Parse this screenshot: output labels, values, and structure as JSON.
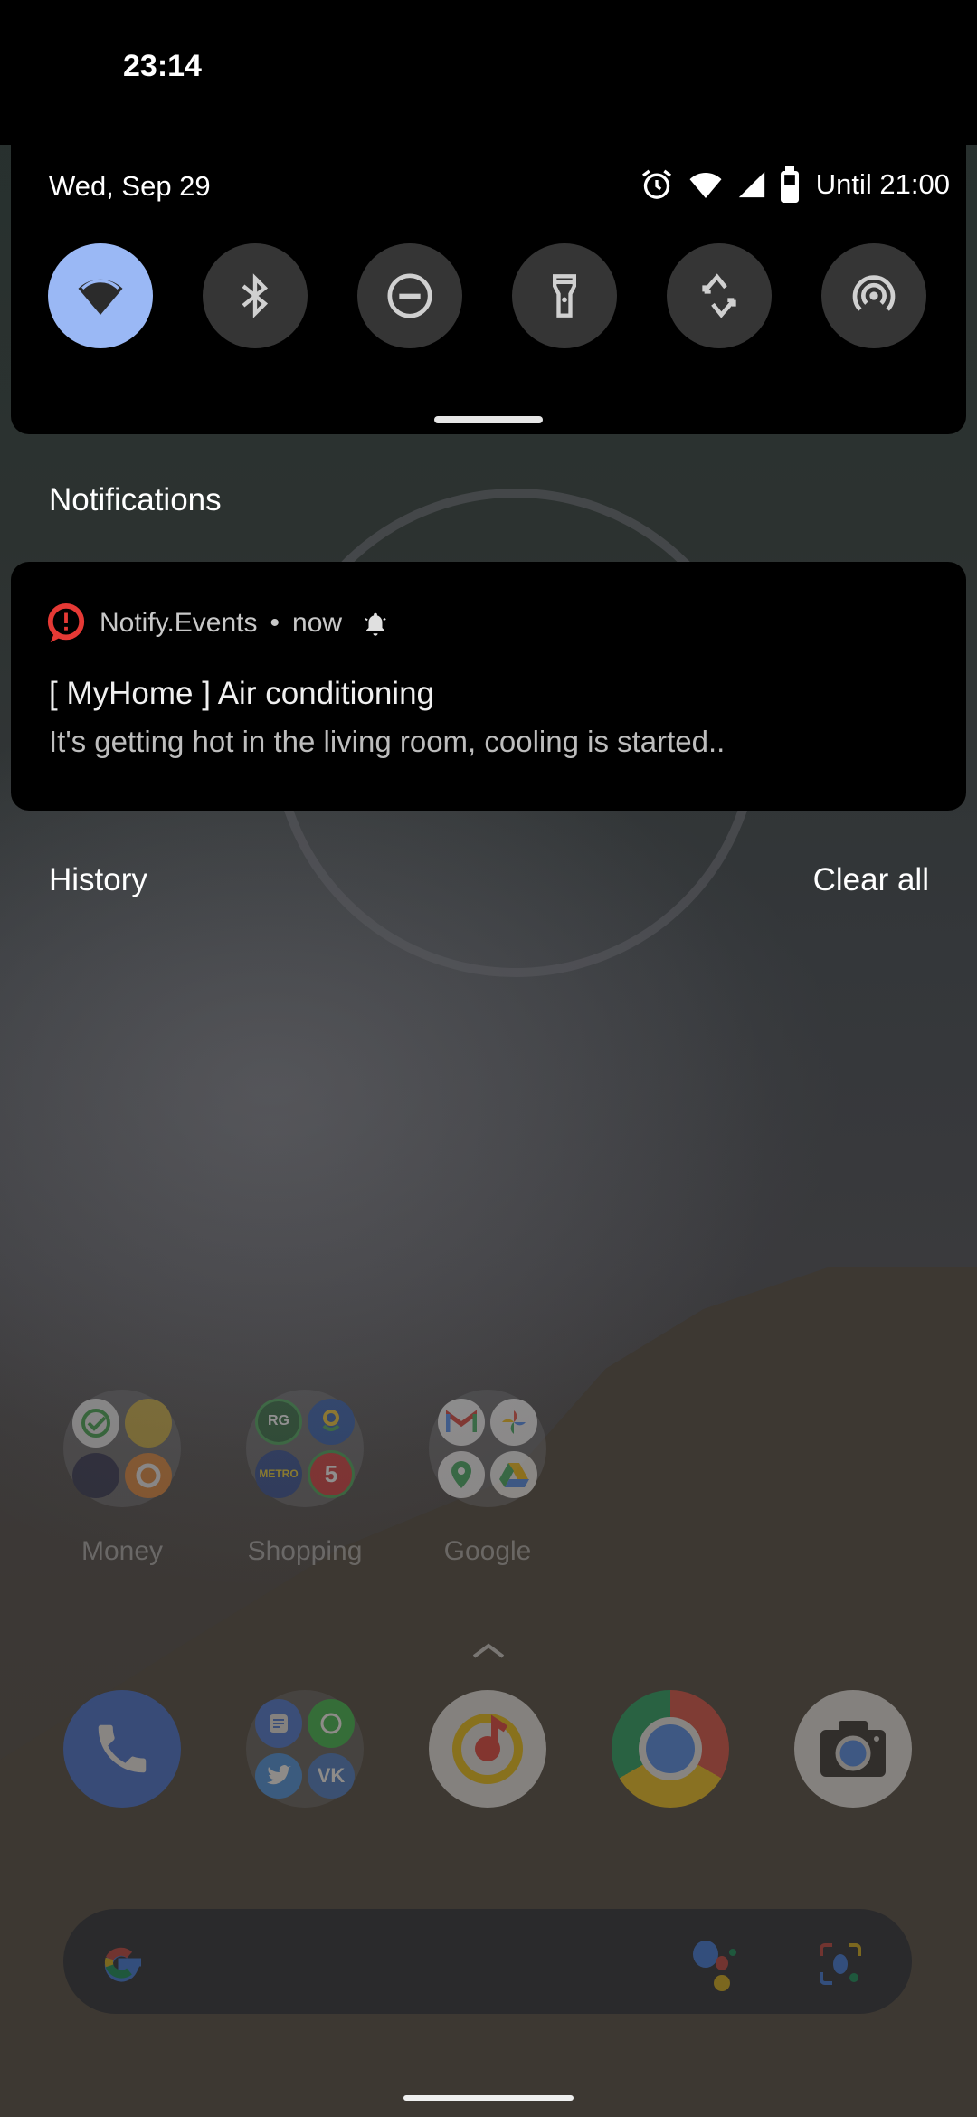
{
  "status_bar": {
    "time": "23:14"
  },
  "quick_settings": {
    "date": "Wed, Sep 29",
    "battery_text": "Until 21:00",
    "status_icons": [
      "alarm-icon",
      "wifi-icon",
      "cell-signal-icon",
      "battery-icon"
    ],
    "tiles": [
      {
        "name": "wifi",
        "icon": "wifi-icon",
        "active": true
      },
      {
        "name": "bluetooth",
        "icon": "bluetooth-icon",
        "active": false
      },
      {
        "name": "do-not-disturb",
        "icon": "dnd-icon",
        "active": false
      },
      {
        "name": "flashlight",
        "icon": "flashlight-icon",
        "active": false
      },
      {
        "name": "auto-rotate",
        "icon": "rotate-icon",
        "active": false
      },
      {
        "name": "hotspot",
        "icon": "hotspot-icon",
        "active": false
      }
    ],
    "colors": {
      "active_tile": "#9ab8f5",
      "inactive_tile": "#353535"
    }
  },
  "notifications": {
    "header": "Notifications",
    "items": [
      {
        "app_name": "Notify.Events",
        "separator": "•",
        "time": "now",
        "title": "[ MyHome ] Air conditioning",
        "body": "It's getting hot in the living room, cooling is started..",
        "app_icon_color": "#e53935"
      }
    ],
    "history_label": "History",
    "clear_all_label": "Clear all"
  },
  "home_screen": {
    "folders": [
      {
        "label": "Money",
        "apps": [
          "Sberbank",
          "Finance",
          "Tax",
          "Wallet"
        ]
      },
      {
        "label": "Shopping",
        "apps": [
          "RG",
          "Perekrestok",
          "METRO",
          "Pyaterochka"
        ]
      },
      {
        "label": "Google",
        "apps": [
          "Gmail",
          "Photos",
          "Maps",
          "Drive"
        ]
      }
    ],
    "dock": [
      "Phone",
      "Social",
      "Music",
      "Chrome",
      "Camera"
    ],
    "mini_labels": {
      "rg": "RG",
      "metro": "METRO",
      "five": "5",
      "g": "G"
    }
  }
}
